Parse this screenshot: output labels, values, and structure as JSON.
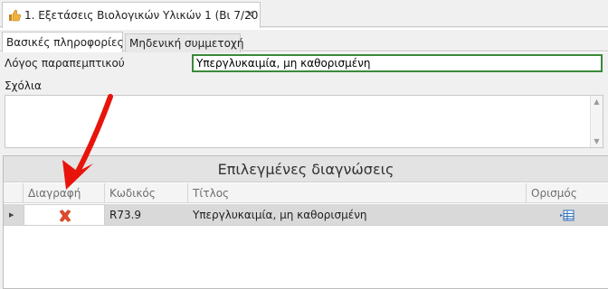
{
  "document_tab": {
    "title": "1. Εξετάσεις Βιολογικών Υλικών 1 (Βι 7/20",
    "icon": "thumbs-up-icon",
    "close_label": "✕"
  },
  "subtabs": [
    {
      "label": "Βασικές πληροφορίες",
      "active": true
    },
    {
      "label": "Μηδενική συμμετοχή",
      "active": false
    }
  ],
  "form": {
    "reason_label": "Λόγος παραπεμπτικού",
    "reason_value": "Υπεργλυκαιμία, μη καθορισμένη",
    "comments_label": "Σχόλια",
    "comments_value": ""
  },
  "diagnoses": {
    "header": "Επιλεγμένες διαγνώσεις",
    "columns": {
      "delete": "Διαγραφή",
      "code": "Κωδικός",
      "title": "Τίτλος",
      "define": "Ορισμός"
    },
    "rows": [
      {
        "code": "R73.9",
        "title": "Υπεργλυκαιμία, μη καθορισμένη"
      }
    ]
  },
  "colors": {
    "active_field_border": "#3a8a3a",
    "delete_icon": "#e04a2a",
    "annotation_arrow": "#e8140c",
    "selected_row": "#d9d9d9"
  }
}
